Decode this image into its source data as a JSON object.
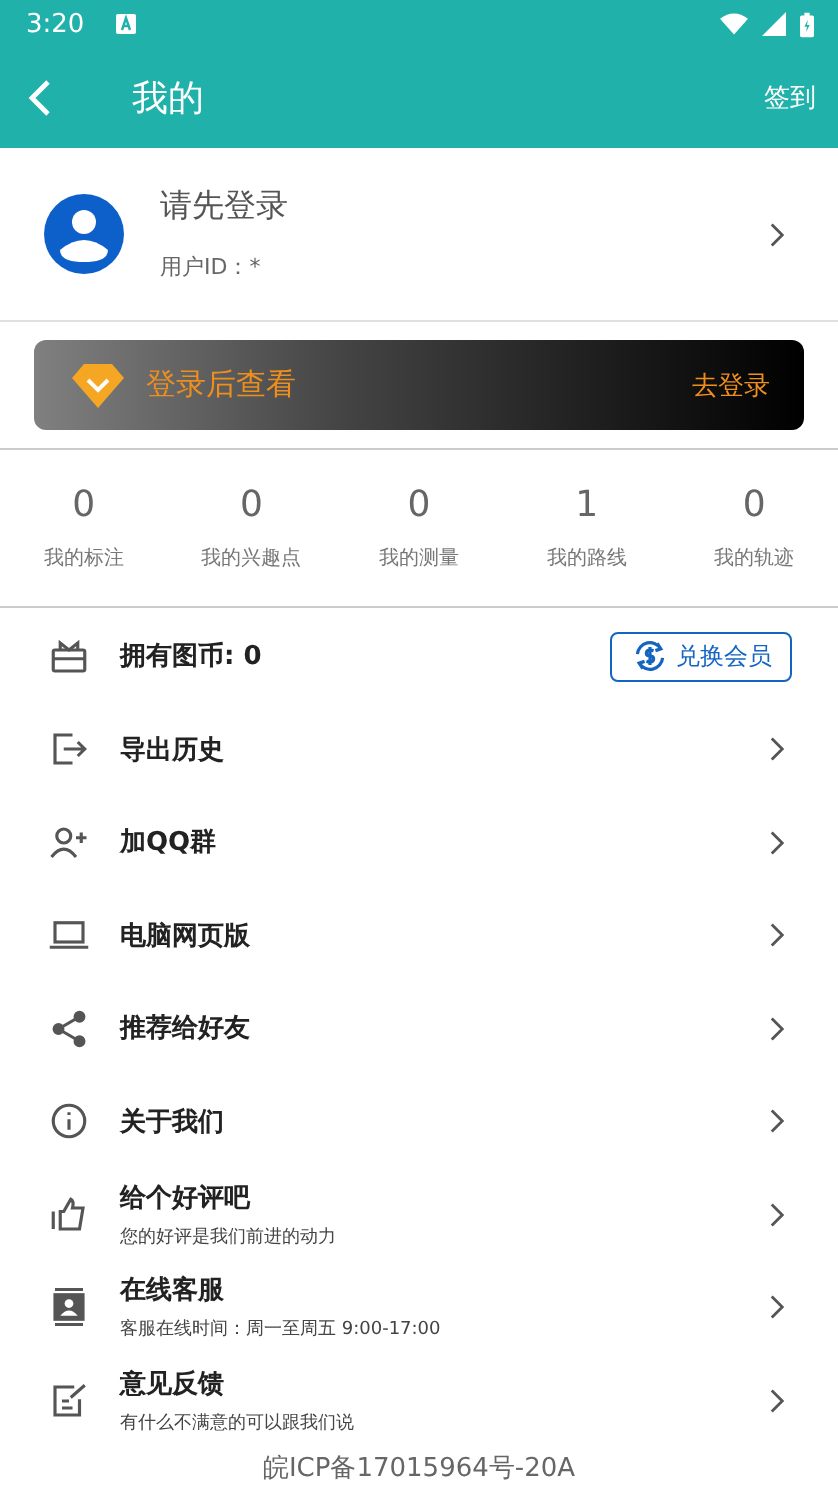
{
  "status_bar": {
    "time": "3:20"
  },
  "toolbar": {
    "title": "我的",
    "action": "签到"
  },
  "profile": {
    "name": "请先登录",
    "user_id": "用户ID：*"
  },
  "vip_banner": {
    "text": "登录后查看",
    "action": "去登录"
  },
  "stats": [
    {
      "value": "0",
      "label": "我的标注"
    },
    {
      "value": "0",
      "label": "我的兴趣点"
    },
    {
      "value": "0",
      "label": "我的测量"
    },
    {
      "value": "1",
      "label": "我的路线"
    },
    {
      "value": "0",
      "label": "我的轨迹"
    }
  ],
  "menu": [
    {
      "kind": "coins",
      "title": "拥有图币: 0",
      "button": "兑换会员"
    },
    {
      "kind": "link",
      "title": "导出历史"
    },
    {
      "kind": "link",
      "title": "加QQ群"
    },
    {
      "kind": "link",
      "title": "电脑网页版"
    },
    {
      "kind": "link",
      "title": "推荐给好友"
    },
    {
      "kind": "link",
      "title": "关于我们"
    },
    {
      "kind": "link",
      "title": "给个好评吧",
      "subtitle": "您的好评是我们前进的动力"
    },
    {
      "kind": "link",
      "title": "在线客服",
      "subtitle": "客服在线时间：周一至周五 9:00-17:00"
    },
    {
      "kind": "link",
      "title": "意见反馈",
      "subtitle": "有什么不满意的可以跟我们说"
    }
  ],
  "footer": "皖ICP备17015964号-20A"
}
